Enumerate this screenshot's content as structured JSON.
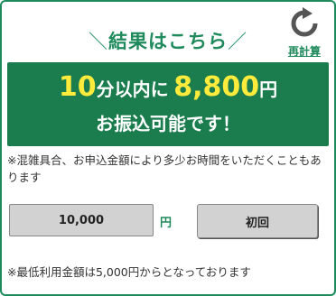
{
  "heading": {
    "left_deco": "＼",
    "title": "結果はこちら",
    "right_deco": "／"
  },
  "recalc": {
    "icon": "refresh-icon",
    "label": "再計算"
  },
  "result": {
    "minutes": "10",
    "minutes_unit": "分以内に",
    "amount": "8,800",
    "amount_unit": "円",
    "message": "お振込可能です！"
  },
  "notes": {
    "congestion": "※混雑具合、お申込金額により多少お時間をいただくこともあります",
    "minimum": "※最低利用金額は5,000円からとなっております"
  },
  "form": {
    "amount_value": "10,000",
    "currency": "円",
    "first_time_label": "初回"
  },
  "colors": {
    "accent": "#1f8a5c",
    "result_background": "#1b7d4e",
    "highlight": "#ffeb3b"
  }
}
